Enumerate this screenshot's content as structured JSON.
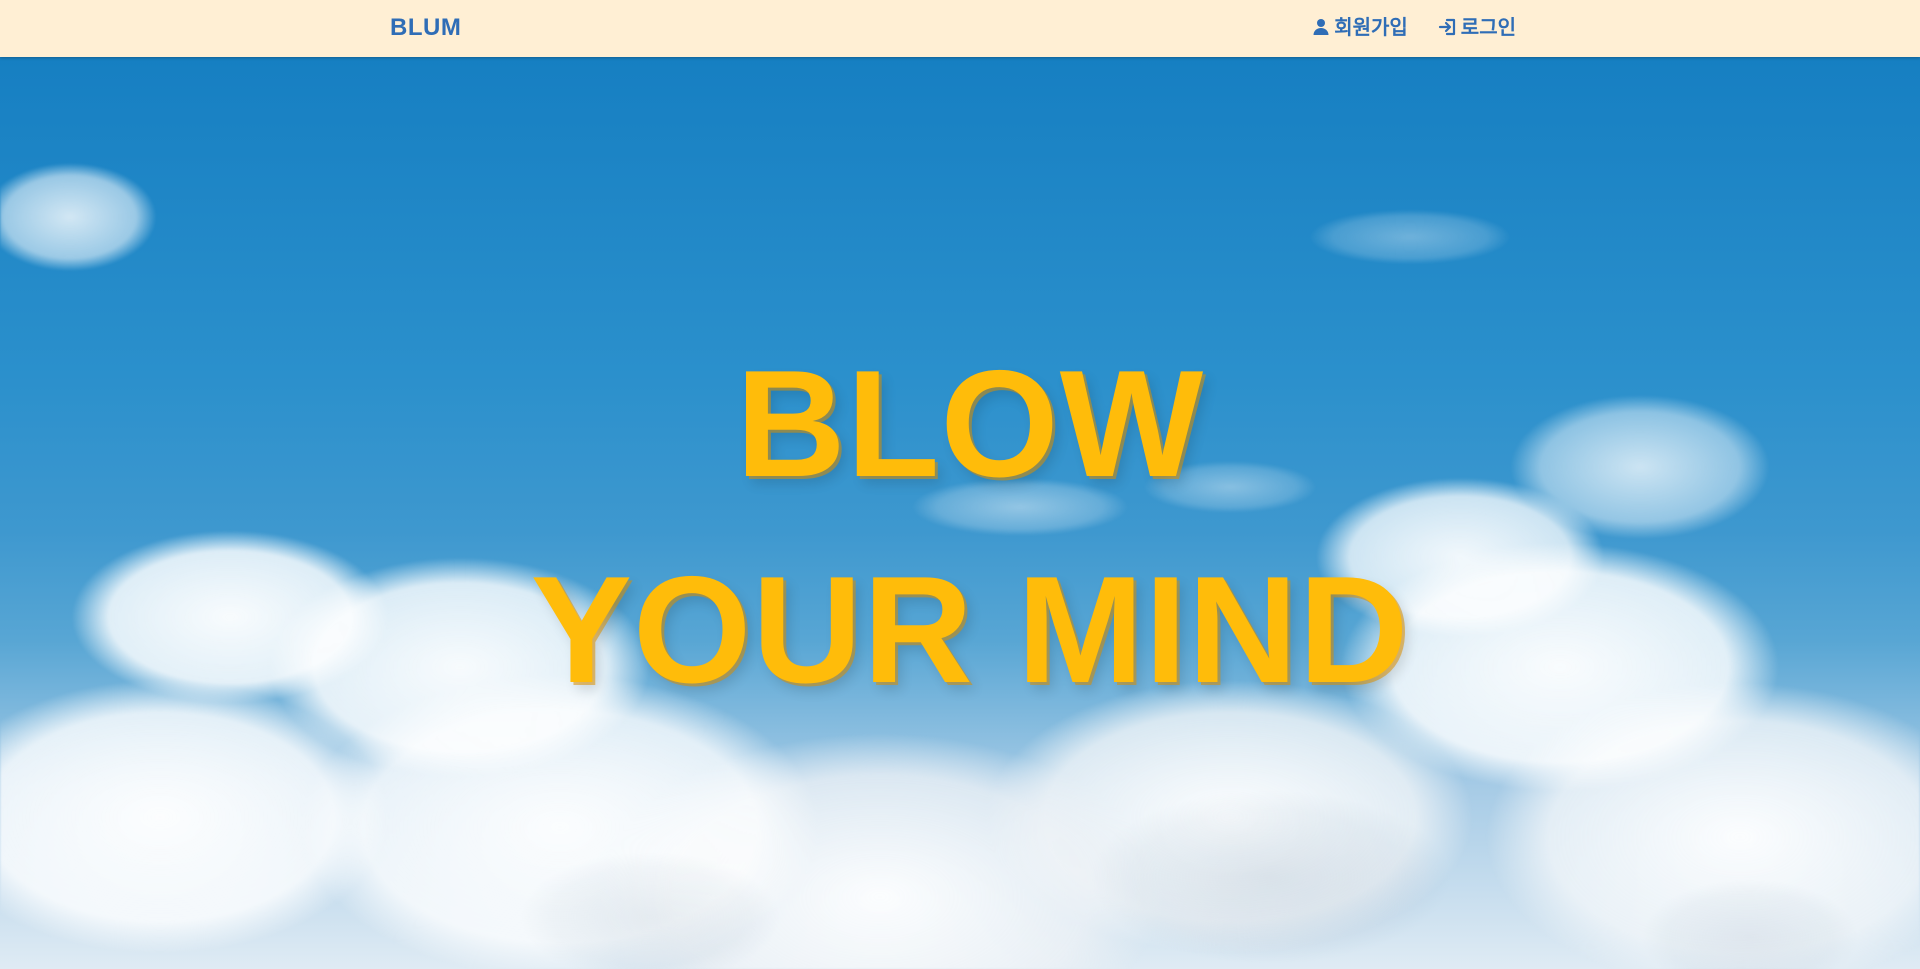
{
  "navbar": {
    "brand": "BLUM",
    "signup_label": "회원가입",
    "login_label": "로그인",
    "icons": {
      "signup": "user-icon",
      "login": "sign-in-icon"
    }
  },
  "hero": {
    "headline": "BLOW YOUR MIND"
  },
  "colors": {
    "navbar_bg": "#FFEFD4",
    "nav_text": "#2F6DB6",
    "headline": "#FFBC0A"
  }
}
